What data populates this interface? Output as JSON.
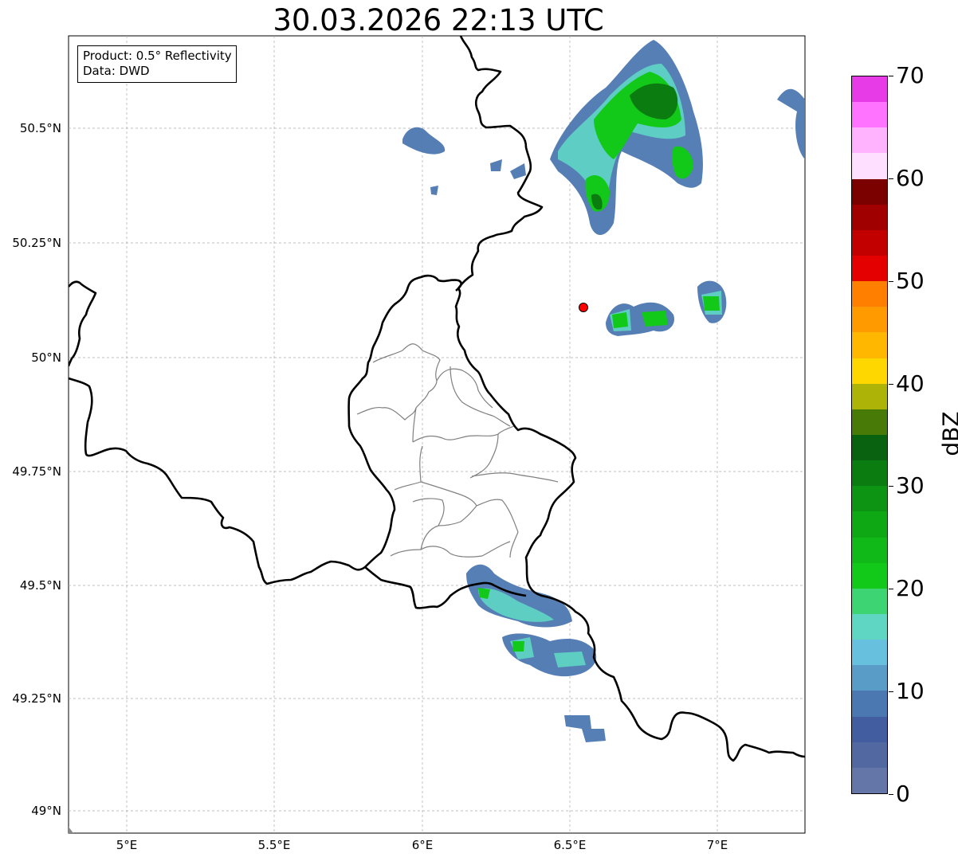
{
  "title": "30.03.2026 22:13 UTC",
  "info": {
    "product": "Product: 0.5° Reflectivity",
    "data": "Data: DWD"
  },
  "map": {
    "lat_ticks": [
      "50.5°N",
      "50.25°N",
      "50°N",
      "49.75°N",
      "49.5°N",
      "49.25°N",
      "49°N"
    ],
    "lon_ticks": [
      "5°E",
      "5.5°E",
      "6°E",
      "6.5°E",
      "7°E"
    ],
    "lon_range": [
      4.8,
      7.3
    ],
    "lat_range": [
      48.95,
      50.7
    ],
    "radar_site": {
      "lon": 6.55,
      "lat": 50.11,
      "color": "#ff0000"
    }
  },
  "colorbar": {
    "label": "dBZ",
    "ticks": [
      "0",
      "10",
      "20",
      "30",
      "40",
      "50",
      "60",
      "70"
    ],
    "range": [
      0,
      70
    ],
    "colors": [
      "#6476a8",
      "#5168a0",
      "#425da0",
      "#4c78b1",
      "#5a9cc8",
      "#67c0de",
      "#5fd6c4",
      "#3dd474",
      "#12c818",
      "#10b818",
      "#0fa815",
      "#0e9413",
      "#0b7d10",
      "#096210",
      "#487a08",
      "#aeb308",
      "#ffd700",
      "#ffb700",
      "#ff9b00",
      "#ff7f00",
      "#e50000",
      "#c20000",
      "#a00000",
      "#7b0000",
      "#ffdfff",
      "#ffb3ff",
      "#ff73ff",
      "#e83be8"
    ]
  }
}
